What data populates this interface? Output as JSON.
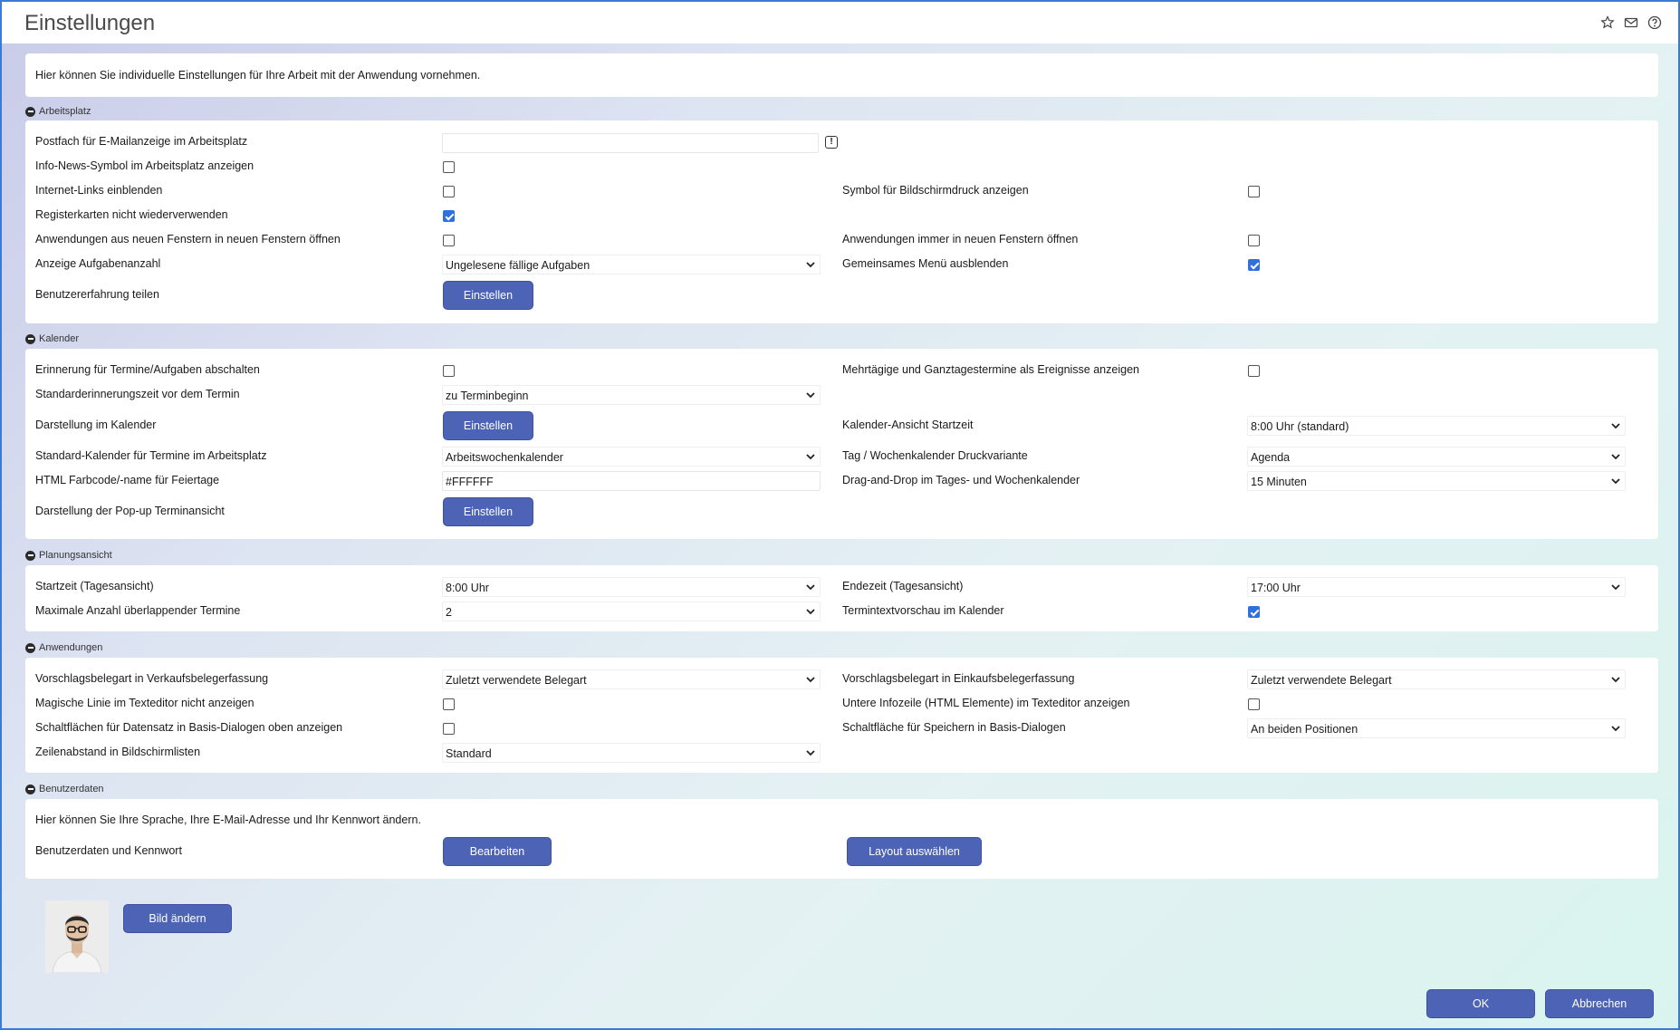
{
  "window": {
    "title": "Einstellungen"
  },
  "intro": "Hier können Sie individuelle Einstellungen für Ihre Arbeit mit der Anwendung vornehmen.",
  "icons": {
    "favorite": "star-icon",
    "mail": "mail-icon",
    "help": "help-icon",
    "info": "info-icon",
    "section": "minus-circle-icon"
  },
  "colors": {
    "accent": "#4c63b6",
    "checkbox": "#2f6fde",
    "frame": "#3a7bd5"
  },
  "arbeitsplatz": {
    "title": "Arbeitsplatz",
    "postfach": {
      "label": "Postfach für E-Mailanzeige im Arbeitsplatz",
      "value": ""
    },
    "infonews": {
      "label": "Info-News-Symbol im Arbeitsplatz anzeigen",
      "checked": false
    },
    "internetlinks": {
      "label": "Internet-Links einblenden",
      "checked": false
    },
    "bildschirmdruck": {
      "label": "Symbol für Bildschirmdruck anzeigen",
      "checked": false
    },
    "registerkarten": {
      "label": "Registerkarten nicht wiederverwenden",
      "checked": true
    },
    "neuefenster": {
      "label": "Anwendungen aus neuen Fenstern in neuen Fenstern öffnen",
      "checked": false
    },
    "immerneu": {
      "label": "Anwendungen immer in neuen Fenstern öffnen",
      "checked": false
    },
    "aufgabenanzahl": {
      "label": "Anzeige Aufgabenanzahl",
      "value": "Ungelesene fällige Aufgaben"
    },
    "menu": {
      "label": "Gemeinsames Menü ausblenden",
      "checked": true
    },
    "erfahrung": {
      "label": "Benutzererfahrung teilen",
      "button": "Einstellen"
    }
  },
  "kalender": {
    "title": "Kalender",
    "erinnerung": {
      "label": "Erinnerung für Termine/Aufgaben abschalten",
      "checked": false
    },
    "mehrtaegig": {
      "label": "Mehrtägige und Ganztagestermine als Ereignisse anzeigen",
      "checked": false
    },
    "standarderinnerung": {
      "label": "Standarderinnerungszeit vor dem Termin",
      "value": "zu Terminbeginn"
    },
    "darstellung": {
      "label": "Darstellung im Kalender",
      "button": "Einstellen"
    },
    "startzeit": {
      "label": "Kalender-Ansicht Startzeit",
      "value": "8:00 Uhr (standard)"
    },
    "standardkalender": {
      "label": "Standard-Kalender für Termine im Arbeitsplatz",
      "value": "Arbeitswochenkalender"
    },
    "druckvariante": {
      "label": "Tag / Wochenkalender Druckvariante",
      "value": "Agenda"
    },
    "farbcode": {
      "label": "HTML Farbcode/-name für Feiertage",
      "value": "#FFFFFF"
    },
    "dragdrop": {
      "label": "Drag-and-Drop im Tages- und Wochenkalender",
      "value": "15 Minuten"
    },
    "popup": {
      "label": "Darstellung der Pop-up Terminansicht",
      "button": "Einstellen"
    }
  },
  "planung": {
    "title": "Planungsansicht",
    "startzeit": {
      "label": "Startzeit (Tagesansicht)",
      "value": "8:00 Uhr"
    },
    "endezeit": {
      "label": "Endezeit (Tagesansicht)",
      "value": "17:00 Uhr"
    },
    "maxanzahl": {
      "label": "Maximale Anzahl überlappender Termine",
      "value": "2"
    },
    "textvorschau": {
      "label": "Termintextvorschau im Kalender",
      "checked": true
    }
  },
  "anwendungen": {
    "title": "Anwendungen",
    "verkauf": {
      "label": "Vorschlagsbelegart in Verkaufsbelegerfassung",
      "value": "Zuletzt verwendete Belegart"
    },
    "einkauf": {
      "label": "Vorschlagsbelegart in Einkaufsbelegerfassung",
      "value": "Zuletzt verwendete Belegart"
    },
    "magisch": {
      "label": "Magische Linie im Texteditor nicht anzeigen",
      "checked": false
    },
    "infozeile": {
      "label": "Untere Infozeile (HTML Elemente) im Texteditor anzeigen",
      "checked": false
    },
    "schaltflaechen": {
      "label": "Schaltflächen für Datensatz in Basis-Dialogen oben anzeigen",
      "checked": false
    },
    "speichern": {
      "label": "Schaltfläche für Speichern in Basis-Dialogen",
      "value": "An beiden Positionen"
    },
    "zeilenabstand": {
      "label": "Zeilenabstand in Bildschirmlisten",
      "value": "Standard"
    }
  },
  "benutzer": {
    "title": "Benutzerdaten",
    "text": "Hier können Sie Ihre Sprache, Ihre E-Mail-Adresse und Ihr Kennwort ändern.",
    "label": "Benutzerdaten und Kennwort",
    "bearbeiten": "Bearbeiten",
    "layout": "Layout auswählen"
  },
  "bild": {
    "button": "Bild ändern"
  },
  "footer": {
    "ok": "OK",
    "cancel": "Abbrechen"
  }
}
